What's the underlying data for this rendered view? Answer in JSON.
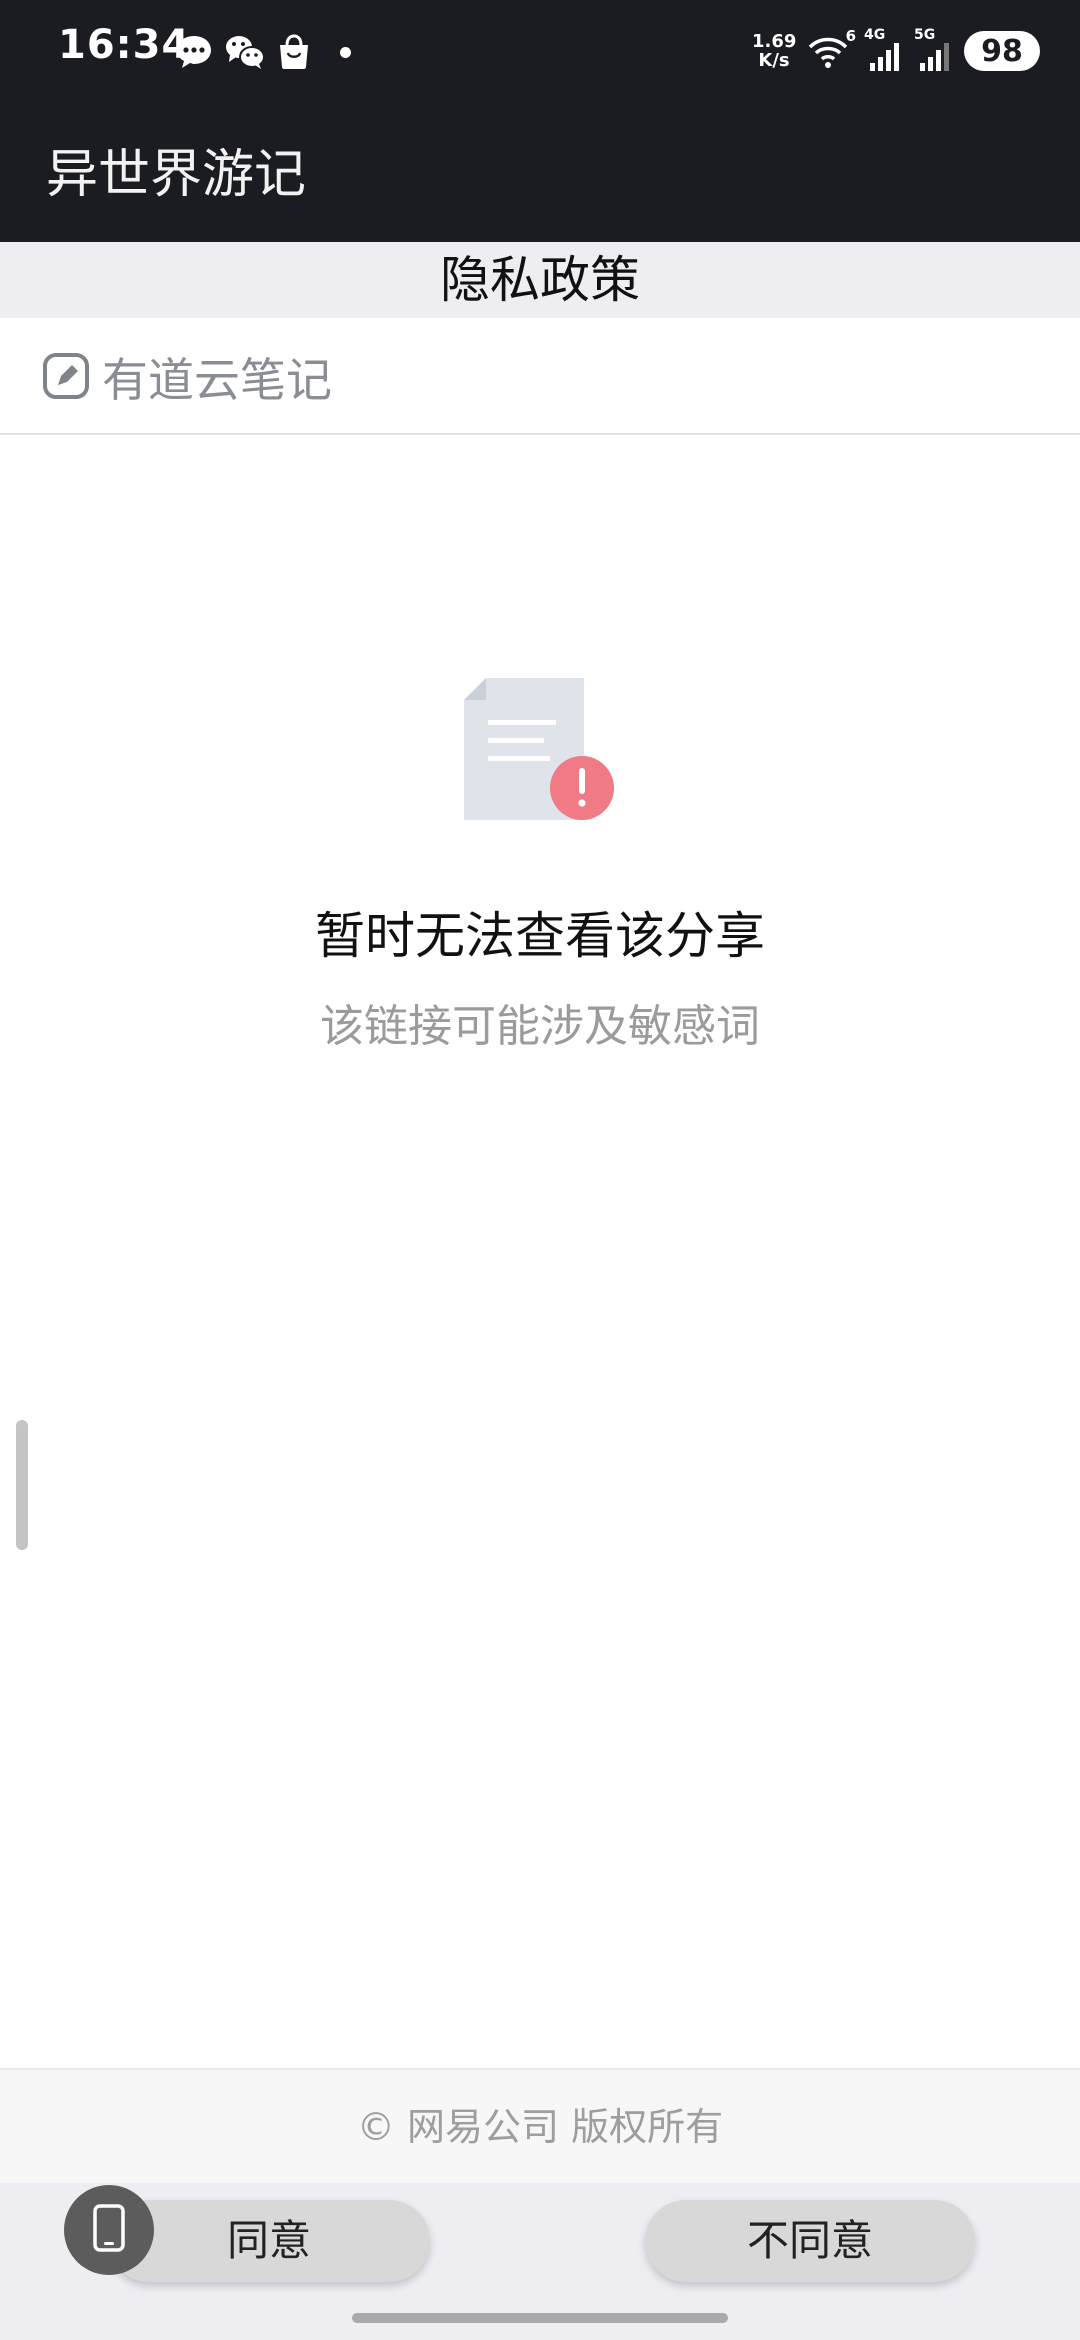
{
  "status_bar": {
    "time": "16:34",
    "net_speed_value": "1.69",
    "net_speed_unit": "K/s",
    "wifi_label": "6",
    "sim1_label": "4G",
    "sim2_label": "5G",
    "battery": "98",
    "notification_icons": [
      "message-bubble-icon",
      "wechat-icon",
      "shopping-bag-icon"
    ]
  },
  "app_bar": {
    "title": "异世界游记"
  },
  "policy": {
    "title": "隐私政策"
  },
  "note_header": {
    "icon": "youdao-note-icon",
    "label": "有道云笔记"
  },
  "empty_state": {
    "icon": "document-error-icon",
    "title": "暂时无法查看该分享",
    "subtitle": "该链接可能涉及敏感词"
  },
  "footer": {
    "copyright": "© 网易公司 版权所有"
  },
  "actions": {
    "agree_label": "同意",
    "disagree_label": "不同意"
  },
  "colors": {
    "dark_bar": "#1b1c21",
    "header_gray": "#eeedf2",
    "error_badge": "#f07b86",
    "button_gray": "#d8d8d8"
  }
}
